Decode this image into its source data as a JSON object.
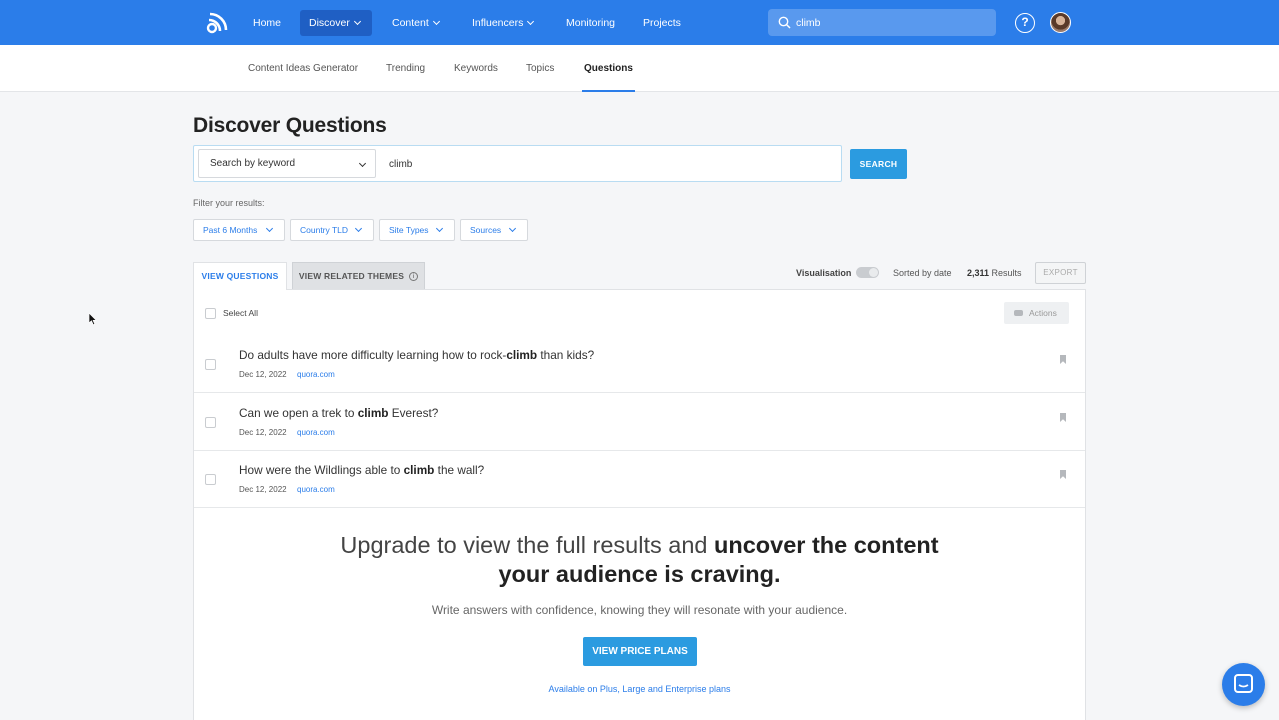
{
  "nav": {
    "items": [
      {
        "label": "Home"
      },
      {
        "label": "Discover"
      },
      {
        "label": "Content"
      },
      {
        "label": "Influencers"
      },
      {
        "label": "Monitoring"
      },
      {
        "label": "Projects"
      }
    ],
    "search_value": "climb"
  },
  "subnav": {
    "items": [
      {
        "label": "Content Ideas Generator"
      },
      {
        "label": "Trending"
      },
      {
        "label": "Keywords"
      },
      {
        "label": "Topics"
      },
      {
        "label": "Questions"
      }
    ]
  },
  "page": {
    "title": "Discover Questions",
    "search_mode": "Search by keyword",
    "keyword_value": "climb",
    "search_button": "SEARCH",
    "filter_label": "Filter your results:",
    "filters": [
      {
        "label": "Past 6 Months"
      },
      {
        "label": "Country TLD"
      },
      {
        "label": "Site Types"
      },
      {
        "label": "Sources"
      }
    ]
  },
  "tabs": {
    "view_questions": "VIEW QUESTIONS",
    "view_themes": "VIEW RELATED THEMES"
  },
  "toolbar": {
    "visualisation": "Visualisation",
    "sorted": "Sorted by date",
    "results_count": "2,311",
    "results_label": "Results",
    "export": "EXPORT",
    "select_all": "Select All",
    "actions": "Actions"
  },
  "questions": [
    {
      "pre": "Do adults have more difficulty learning how to rock-",
      "kw": "climb",
      "post": " than kids?",
      "date": "Dec 12, 2022",
      "source": "quora.com"
    },
    {
      "pre": "Can we open a trek to ",
      "kw": "climb",
      "post": " Everest?",
      "date": "Dec 12, 2022",
      "source": "quora.com"
    },
    {
      "pre": "How were the Wildlings able to ",
      "kw": "climb",
      "post": " the wall?",
      "date": "Dec 12, 2022",
      "source": "quora.com"
    }
  ],
  "upgrade": {
    "line1_pre": "Upgrade to view the full results and ",
    "line1_bold": "uncover the content",
    "line2_bold": "your audience is craving.",
    "subtitle": "Write answers with confidence, knowing they will resonate with your audience.",
    "button": "VIEW PRICE PLANS",
    "availability": "Available on Plus, Large and Enterprise plans"
  },
  "colors": {
    "brand_blue": "#2b7de9",
    "button_blue": "#2b9be0"
  }
}
